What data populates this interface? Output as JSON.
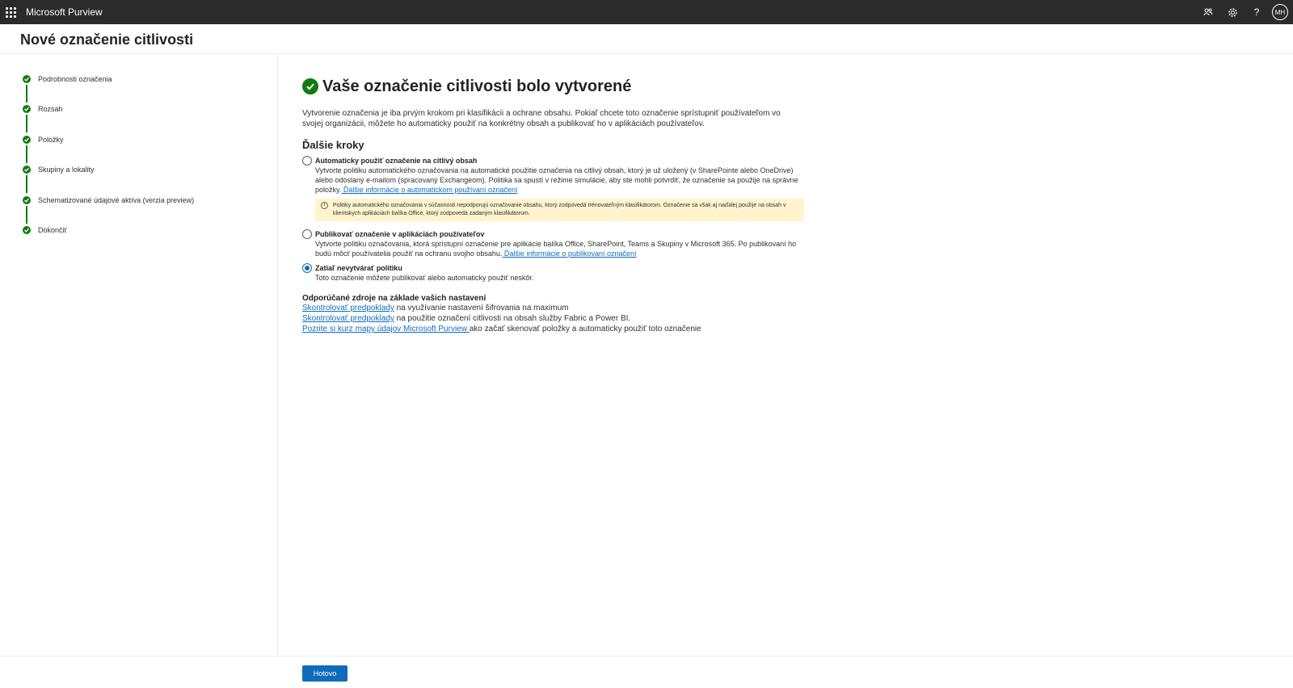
{
  "topbar": {
    "app_name": "Microsoft Purview",
    "avatar_initials": "MH",
    "help_label": "?"
  },
  "page": {
    "title": "Nové označenie citlivosti"
  },
  "steps": [
    {
      "label": "Podrobnosti označenia",
      "status": "completed"
    },
    {
      "label": "Rozsah",
      "status": "completed"
    },
    {
      "label": "Položky",
      "status": "completed"
    },
    {
      "label": "Skupiny a lokality",
      "status": "completed"
    },
    {
      "label": "Schematizované údajové aktíva (verzia preview)",
      "status": "completed"
    },
    {
      "label": "Dokončiť",
      "status": "completed"
    }
  ],
  "main": {
    "success_title": "Vaše označenie citlivosti bolo vytvorené",
    "intro": "Vytvorenie označenia je iba prvým krokom pri klasifikácii a ochrane obsahu. Pokiaľ chcete toto označenie sprístupniť používateľom vo svojej organizácii, môžete ho automaticky použiť na konkrétny obsah a publikovať ho v aplikáciách používateľov.",
    "next_steps_heading": "Ďalšie kroky",
    "options": [
      {
        "title": "Automaticky použiť označenie na citlivý obsah",
        "description": "Vytvorte politiku automatického označovania na automatické použitie označenia na citlivý obsah, ktorý je už uložený (v SharePointe alebo OneDrive) alebo odoslaný e-mailom (spracovaný Exchangeom). Politika sa spustí v režime simulácie, aby ste mohli potvrdiť, že označenie sa použije na správne položky.",
        "link": " Ďalšie informácie o automatickom používaní označení",
        "warning": "Politiky automatického označovania v súčasnosti nepodporujú označovanie obsahu, ktorý zodpovedá trénovateľným klasifikátorom. Označenie sa však aj naďalej použije na obsah v klientskych aplikáciách balíka Office, ktorý zodpovedá zadaným klasifikátorom.",
        "selected": false
      },
      {
        "title": "Publikovať označenie v aplikáciách používateľov",
        "description": "Vytvorte politiku označovania, ktorá sprístupní označenie pre aplikácie balíka Office, SharePoint, Teams a Skupiny v Microsoft 365. Po publikovaní ho budú môcť používatelia použiť na ochranu svojho obsahu.",
        "link": " Ďalšie informácie o publikovaní označení",
        "selected": false
      },
      {
        "title": "Zatiaľ nevytvárať politiku",
        "description": "Toto označenie môžete publikovať alebo automaticky použiť neskôr.",
        "selected": true
      }
    ],
    "resources_heading": "Odporúčané zdroje na základe vašich nastavení",
    "resources": [
      {
        "link": "Skontrolovať predpoklady",
        "text": " na využívanie nastavení šifrovania na maximum"
      },
      {
        "link": "Skontrolovať predpoklady",
        "text": " na použitie označení citlivosti na obsah služby Fabric a Power BI."
      },
      {
        "link": "Pozrite si kurz mapy údajov Microsoft Purview ",
        "text": "ako začať skenovať položky a automaticky použiť toto označenie"
      }
    ]
  },
  "footer": {
    "done_label": "Hotovo"
  },
  "colors": {
    "topbar": "#2b2b2b",
    "success_green": "#107c10",
    "primary_blue": "#0f6cbd",
    "warning_bg": "#fff4ce"
  },
  "icons": {
    "app_launcher": "waffle-icon",
    "topbar_1": "people-icon",
    "topbar_2": "gear-icon",
    "topbar_3": "help-icon",
    "success": "checkmark-circle-icon",
    "warning": "info-icon"
  }
}
